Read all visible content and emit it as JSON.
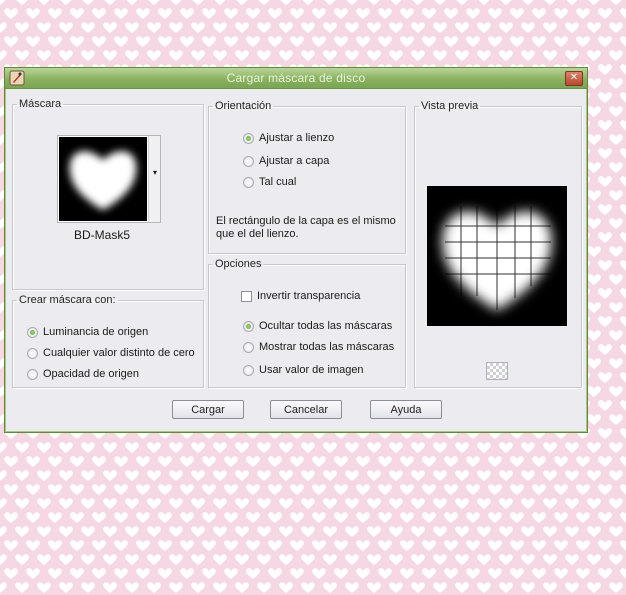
{
  "window": {
    "title": "Cargar máscara de disco",
    "close_symbol": "✕"
  },
  "mask_group": {
    "legend": "Máscara",
    "selected_mask": "BD-Mask5",
    "dropdown_symbol": "▾"
  },
  "orientation_group": {
    "legend": "Orientación",
    "options": [
      {
        "label": "Ajustar a lienzo",
        "selected": true
      },
      {
        "label": "Ajustar a capa",
        "selected": false
      },
      {
        "label": "Tal cual",
        "selected": false
      }
    ],
    "note_line1": "El rectángulo de la capa es el mismo",
    "note_line2": "que el del lienzo."
  },
  "options_group": {
    "legend": "Opciones",
    "invert_label": "Invertir transparencia",
    "invert_checked": false,
    "options": [
      {
        "label": "Ocultar todas las máscaras",
        "selected": true
      },
      {
        "label": "Mostrar todas las máscaras",
        "selected": false
      },
      {
        "label": "Usar valor de imagen",
        "selected": false
      }
    ]
  },
  "create_group": {
    "legend": "Crear máscara con:",
    "options": [
      {
        "label": "Luminancia de origen",
        "selected": true
      },
      {
        "label": "Cualquier valor distinto de cero",
        "selected": false
      },
      {
        "label": "Opacidad de origen",
        "selected": false
      }
    ]
  },
  "preview_group": {
    "legend": "Vista previa"
  },
  "buttons": {
    "load": "Cargar",
    "cancel": "Cancelar",
    "help": "Ayuda"
  },
  "colors": {
    "background_pink": "#f7d9e6",
    "heart_white": "#ffffff",
    "titlebar_green": "#8ab25f",
    "dialog_face": "#ecebf0",
    "radio_selected": "#4f9a2c"
  }
}
